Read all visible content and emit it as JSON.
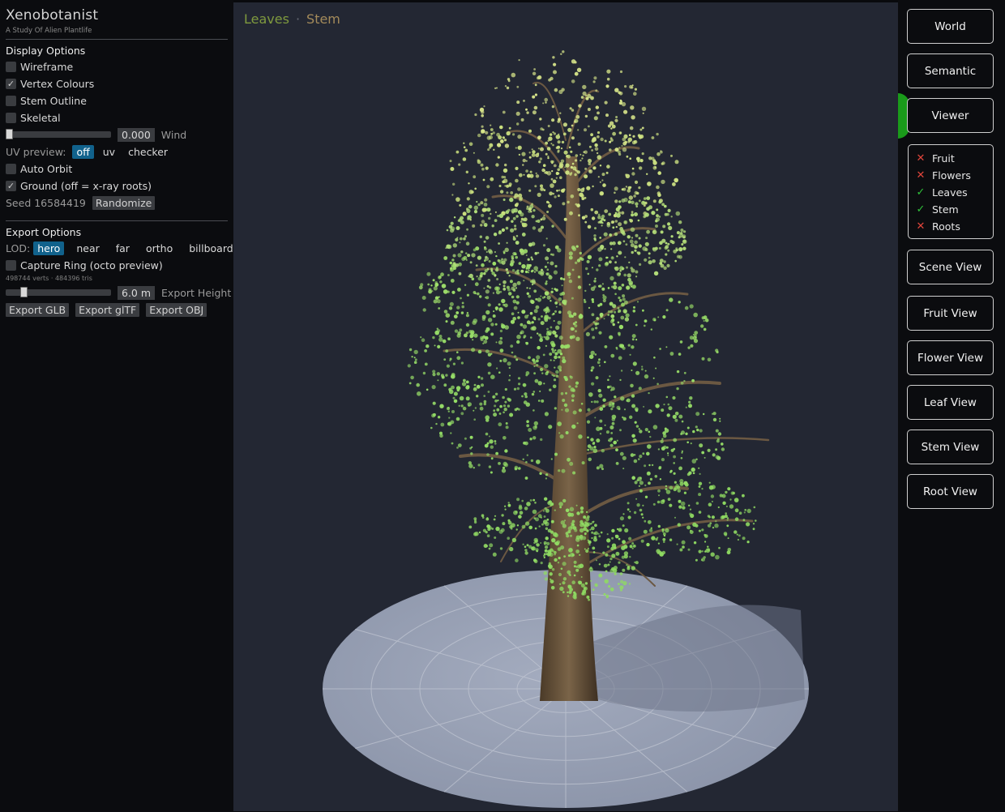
{
  "app": {
    "title": "Xenobotanist",
    "subtitle": "A Study Of Alien Plantlife"
  },
  "display": {
    "heading": "Display Options",
    "wireframe": {
      "label": "Wireframe",
      "checked": false
    },
    "vertex_colours": {
      "label": "Vertex Colours",
      "checked": true
    },
    "stem_outline": {
      "label": "Stem Outline",
      "checked": false
    },
    "skeletal": {
      "label": "Skeletal",
      "checked": false
    },
    "wind": {
      "value": "0.000",
      "label": "Wind",
      "fraction": 0.0
    },
    "uv_preview": {
      "label": "UV preview:",
      "options": [
        "off",
        "uv",
        "checker"
      ],
      "selected": "off"
    },
    "auto_orbit": {
      "label": "Auto Orbit",
      "checked": false
    },
    "ground": {
      "label": "Ground (off = x-ray roots)",
      "checked": true
    },
    "seed": {
      "label": "Seed 16584419",
      "randomize": "Randomize"
    }
  },
  "export": {
    "heading": "Export Options",
    "lod": {
      "label": "LOD:",
      "options": [
        "hero",
        "near",
        "far",
        "ortho",
        "billboard"
      ],
      "selected": "hero"
    },
    "capture_ring": {
      "label": "Capture Ring (octo preview)",
      "checked": false
    },
    "stats": "498744 verts · 484396 tris",
    "height": {
      "value": "6.0 m",
      "label": "Export Height",
      "fraction": 0.15
    },
    "buttons": [
      "Export GLB",
      "Export glTF",
      "Export OBJ"
    ]
  },
  "viewport": {
    "breadcrumb": [
      "Leaves",
      "Stem"
    ],
    "separator": "·"
  },
  "modes": {
    "world": "World",
    "semantic": "Semantic",
    "viewer": "Viewer",
    "active": "Viewer"
  },
  "layers": [
    {
      "label": "Fruit",
      "enabled": false
    },
    {
      "label": "Flowers",
      "enabled": false
    },
    {
      "label": "Leaves",
      "enabled": true
    },
    {
      "label": "Stem",
      "enabled": true
    },
    {
      "label": "Roots",
      "enabled": false
    }
  ],
  "views": [
    "Scene View",
    "Fruit View",
    "Flower View",
    "Leaf View",
    "Stem View",
    "Root View"
  ],
  "icons": {
    "enabled": "check-icon",
    "disabled": "cross-icon"
  },
  "colors": {
    "accent": "#11628c",
    "active_tab": "#1a9a1a",
    "leaf": "#9fe06a",
    "ground": "#8e97ad"
  }
}
